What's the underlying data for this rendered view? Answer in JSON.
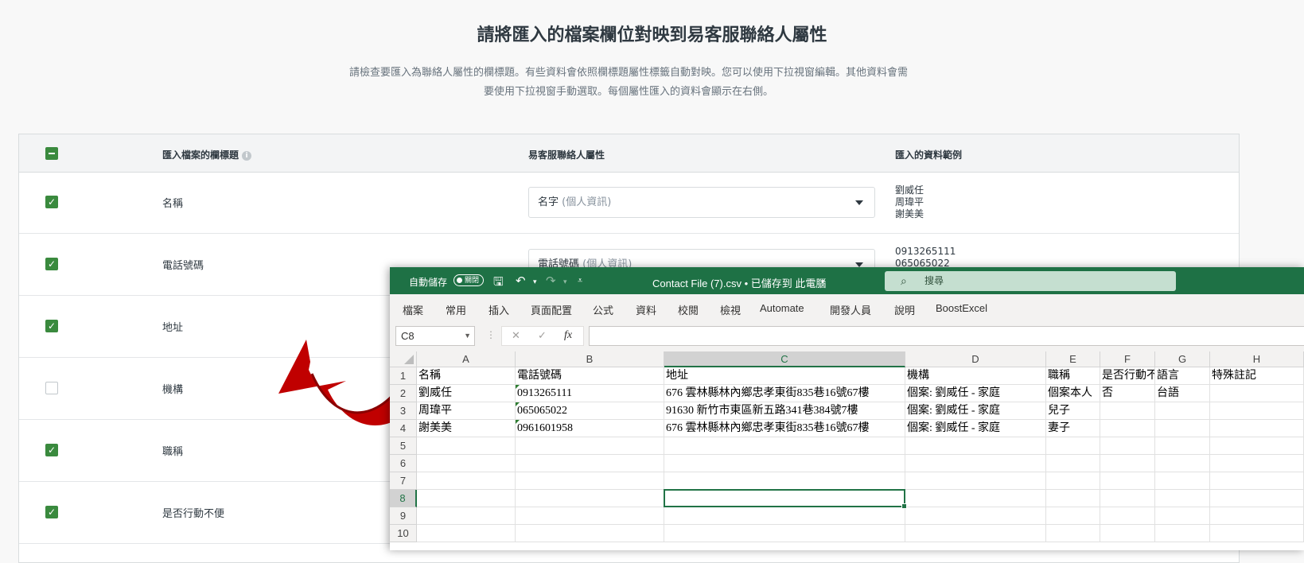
{
  "page": {
    "title": "請將匯入的檔案欄位對映到易客服聯絡人屬性",
    "description_line1": "請檢查要匯入為聯絡人屬性的欄標題。有些資料會依照欄標題屬性標籤自動對映。您可以使用下拉視窗編輯。其他資料會需",
    "description_line2": "要使用下拉視窗手動選取。每個屬性匯入的資料會顯示在右側。"
  },
  "table": {
    "headers": {
      "column_header": "匯入檔案的欄標題",
      "attribute": "易客服聯絡人屬性",
      "sample": "匯入的資料範例"
    },
    "rows": [
      {
        "name": "名稱",
        "checked": true,
        "attribute": "名字",
        "attribute_hint": "(個人資訊)",
        "samples": [
          "劉威任",
          "周瑋平",
          "謝美美"
        ]
      },
      {
        "name": "電話號碼",
        "checked": true,
        "attribute": "電話號碼",
        "attribute_hint": "(個人資訊)",
        "samples": [
          "0913265111",
          "065065022"
        ]
      },
      {
        "name": "地址",
        "checked": true
      },
      {
        "name": "機構",
        "checked": false
      },
      {
        "name": "職稱",
        "checked": true
      },
      {
        "name": "是否行動不便",
        "checked": true
      }
    ]
  },
  "excel": {
    "autosave_label": "自動儲存",
    "autosave_state": "關閉",
    "file_title": "Contact File (7).csv • 已儲存到 此電腦",
    "search_placeholder": "搜尋",
    "menu": [
      "檔案",
      "常用",
      "插入",
      "頁面配置",
      "公式",
      "資料",
      "校閱",
      "檢視",
      "Automate",
      "開發人員",
      "說明",
      "BoostExcel"
    ],
    "name_box": "C8",
    "columns": [
      "A",
      "B",
      "C",
      "D",
      "E",
      "F",
      "G",
      "H"
    ],
    "row_numbers": [
      "1",
      "2",
      "3",
      "4",
      "5",
      "6",
      "7",
      "8",
      "9",
      "10"
    ],
    "cells": [
      [
        "名稱",
        "電話號碼",
        "地址",
        "機構",
        "職稱",
        "是否行動不便",
        "語言",
        "特殊註記"
      ],
      [
        "劉威任",
        "0913265111",
        "676 雲林縣林內鄉忠孝東街835巷16號67樓",
        "個案: 劉威任 - 家庭",
        "個案本人",
        "否",
        "台語",
        ""
      ],
      [
        "周瑋平",
        "065065022",
        "91630 新竹市東區新五路341巷384號7樓",
        "個案: 劉威任 - 家庭",
        "兒子",
        "",
        "",
        ""
      ],
      [
        "謝美美",
        "0961601958",
        "676 雲林縣林內鄉忠孝東街835巷16號67樓",
        "個案: 劉威任 - 家庭",
        "妻子",
        "",
        "",
        ""
      ]
    ]
  },
  "colors": {
    "check_green": "#3a8a3e",
    "excel_green": "#1e7145",
    "arrow_red": "#c00000"
  }
}
